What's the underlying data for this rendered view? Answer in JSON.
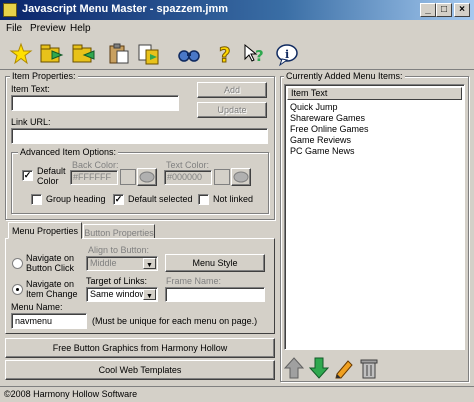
{
  "window": {
    "title": "Javascript Menu Master - spazzem.jmm"
  },
  "menu": [
    "File",
    "Preview",
    "Help"
  ],
  "toolbar": {
    "icons": [
      "new-icon",
      "open-icon",
      "save-icon",
      "paste-icon",
      "copy-icon",
      "preview-icon",
      "help-icon",
      "whats-this-icon",
      "info-icon"
    ]
  },
  "item_properties": {
    "group_label": "Item Properties:",
    "item_text_label": "Item Text:",
    "item_text_value": "",
    "add_label": "Add",
    "update_label": "Update",
    "link_url_label": "Link URL:",
    "link_url_value": ""
  },
  "advanced": {
    "group_label": "Advanced Item Options:",
    "default_color_label": "Default\nColor",
    "default_color_checked": true,
    "back_color_label": "Back Color:",
    "back_color_value": "#FFFFFF",
    "text_color_label": "Text Color:",
    "text_color_value": "#000000",
    "group_heading_label": "Group heading",
    "group_heading_checked": false,
    "default_selected_label": "Default selected",
    "default_selected_checked": true,
    "not_linked_label": "Not linked",
    "not_linked_checked": false
  },
  "tabs": {
    "menu_properties": "Menu Properties",
    "button_properties": "Button Properties"
  },
  "menu_props": {
    "nav_click_label": "Navigate on\nButton Click",
    "nav_change_label": "Navigate on\nItem Change",
    "align_label": "Align to Button:",
    "align_value": "Middle",
    "menu_style_label": "Menu Style",
    "target_label": "Target of Links:",
    "target_value": "Same window",
    "frame_name_label": "Frame Name:",
    "frame_name_value": "",
    "menu_name_label": "Menu Name:",
    "menu_name_value": "navmenu",
    "menu_name_note": "(Must be unique for each menu on page.)"
  },
  "bottom_buttons": {
    "free_graphics": "Free Button Graphics from Harmony Hollow",
    "cool_templates": "Cool Web Templates"
  },
  "list": {
    "group_label": "Currently Added Menu Items:",
    "header": "Item Text",
    "items": [
      "Quick Jump",
      "Shareware Games",
      "Free Online Games",
      "Game Reviews",
      "PC Game News"
    ]
  },
  "list_controls": {
    "icons": [
      "up-arrow-icon",
      "down-arrow-icon",
      "edit-pencil-icon",
      "trash-icon"
    ]
  },
  "status": {
    "text": "©2008 Harmony Hollow Software"
  },
  "colors": {
    "title_start": "#0a246a",
    "title_end": "#a6caf0",
    "face": "#d4d0c8",
    "arrow_green": "#2fa84f"
  }
}
